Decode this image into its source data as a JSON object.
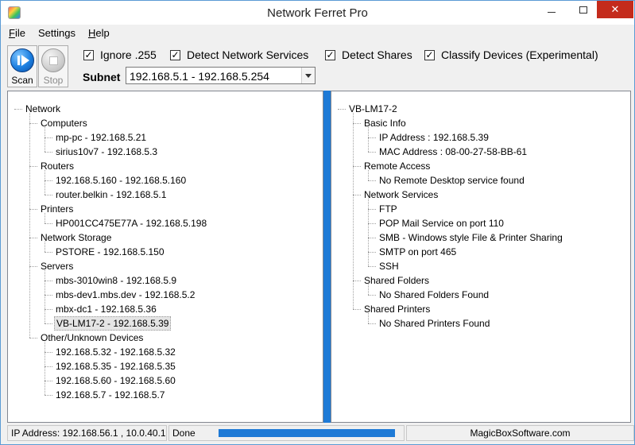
{
  "window": {
    "title": "Network Ferret Pro"
  },
  "menu": [
    {
      "key": "F",
      "rest": "ile"
    },
    {
      "key": "",
      "rest": "Settings"
    },
    {
      "key": "H",
      "rest": "elp"
    }
  ],
  "toolbar": {
    "scan_label": "Scan",
    "stop_label": "Stop"
  },
  "options": {
    "ignore_255": {
      "label": "Ignore .255",
      "checked": true
    },
    "detect_services": {
      "label": "Detect Network Services",
      "checked": true
    },
    "detect_shares": {
      "label": "Detect Shares",
      "checked": true
    },
    "classify_devices": {
      "label": "Classify Devices (Experimental)",
      "checked": true
    }
  },
  "subnet": {
    "label": "Subnet",
    "value": "192.168.5.1 - 192.168.5.254"
  },
  "left_tree": {
    "root": "Network",
    "groups": [
      {
        "label": "Computers",
        "items": [
          "mp-pc - 192.168.5.21",
          "sirius10v7 - 192.168.5.3"
        ]
      },
      {
        "label": "Routers",
        "items": [
          "192.168.5.160 - 192.168.5.160",
          "router.belkin - 192.168.5.1"
        ]
      },
      {
        "label": "Printers",
        "items": [
          "HP001CC475E77A - 192.168.5.198"
        ]
      },
      {
        "label": "Network Storage",
        "items": [
          "PSTORE - 192.168.5.150"
        ]
      },
      {
        "label": "Servers",
        "items": [
          "mbs-3010win8 - 192.168.5.9",
          "mbs-dev1.mbs.dev - 192.168.5.2",
          "mbx-dc1 - 192.168.5.36",
          "VB-LM17-2 - 192.168.5.39"
        ]
      },
      {
        "label": "Other/Unknown Devices",
        "items": [
          "192.168.5.32 - 192.168.5.32",
          "192.168.5.35 - 192.168.5.35",
          "192.168.5.60 - 192.168.5.60",
          "192.168.5.7 - 192.168.5.7"
        ]
      }
    ],
    "selected": "VB-LM17-2 - 192.168.5.39"
  },
  "right_tree": {
    "root": "VB-LM17-2",
    "groups": [
      {
        "label": "Basic Info",
        "items": [
          "IP Address : 192.168.5.39",
          "MAC Address : 08-00-27-58-BB-61"
        ]
      },
      {
        "label": "Remote Access",
        "items": [
          "No Remote Desktop service found"
        ]
      },
      {
        "label": "Network Services",
        "items": [
          "FTP",
          "POP Mail Service on port 110",
          "SMB - Windows style File & Printer Sharing",
          "SMTP on port 465",
          "SSH"
        ]
      },
      {
        "label": "Shared Folders",
        "items": [
          "No Shared Folders Found"
        ]
      },
      {
        "label": "Shared Printers",
        "items": [
          "No Shared Printers Found"
        ]
      }
    ]
  },
  "status": {
    "ip_addresses": "IP Address: 192.168.56.1 , 10.0.40.1 , 1",
    "state": "Done",
    "progress": 1.0,
    "vendor": "MagicBoxSoftware.com"
  },
  "colors": {
    "accent": "#1e7ad6",
    "close": "#c42b1c"
  }
}
